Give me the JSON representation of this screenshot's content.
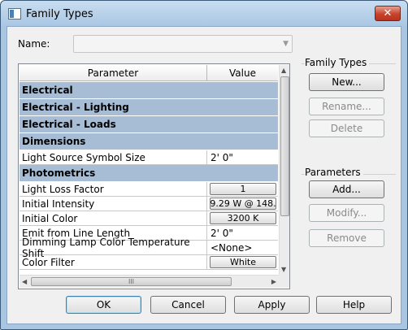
{
  "window": {
    "title": "Family Types",
    "close_glyph": "✕"
  },
  "name_field": {
    "label": "Name:",
    "value": ""
  },
  "grid": {
    "headers": [
      "Parameter",
      "Value"
    ],
    "rows": [
      {
        "kind": "group",
        "label": "Electrical"
      },
      {
        "kind": "group",
        "label": "Electrical - Lighting"
      },
      {
        "kind": "group",
        "label": "Electrical - Loads"
      },
      {
        "kind": "group",
        "label": "Dimensions"
      },
      {
        "kind": "param",
        "label": "Light Source Symbol Size",
        "value": "2'  0\""
      },
      {
        "kind": "group",
        "label": "Photometrics"
      },
      {
        "kind": "param",
        "label": "Light Loss Factor",
        "value": "1",
        "button": true
      },
      {
        "kind": "param",
        "label": "Initial Intensity",
        "value": "9.29 W @ 148.",
        "button": true
      },
      {
        "kind": "param",
        "label": "Initial Color",
        "value": "3200 K",
        "button": true
      },
      {
        "kind": "param",
        "label": "Emit from Line Length",
        "value": "2'  0\""
      },
      {
        "kind": "param",
        "label": "Dimming Lamp Color Temperature Shift",
        "value": "<None>"
      },
      {
        "kind": "param",
        "label": "Color Filter",
        "value": "White",
        "button": true
      }
    ],
    "hscroll_grip": "III"
  },
  "family_types": {
    "label": "Family Types",
    "new": "New...",
    "rename": "Rename...",
    "delete": "Delete"
  },
  "parameters": {
    "label": "Parameters",
    "add": "Add...",
    "modify": "Modify...",
    "remove": "Remove"
  },
  "footer": {
    "ok": "OK",
    "cancel": "Cancel",
    "apply": "Apply",
    "help": "Help"
  }
}
